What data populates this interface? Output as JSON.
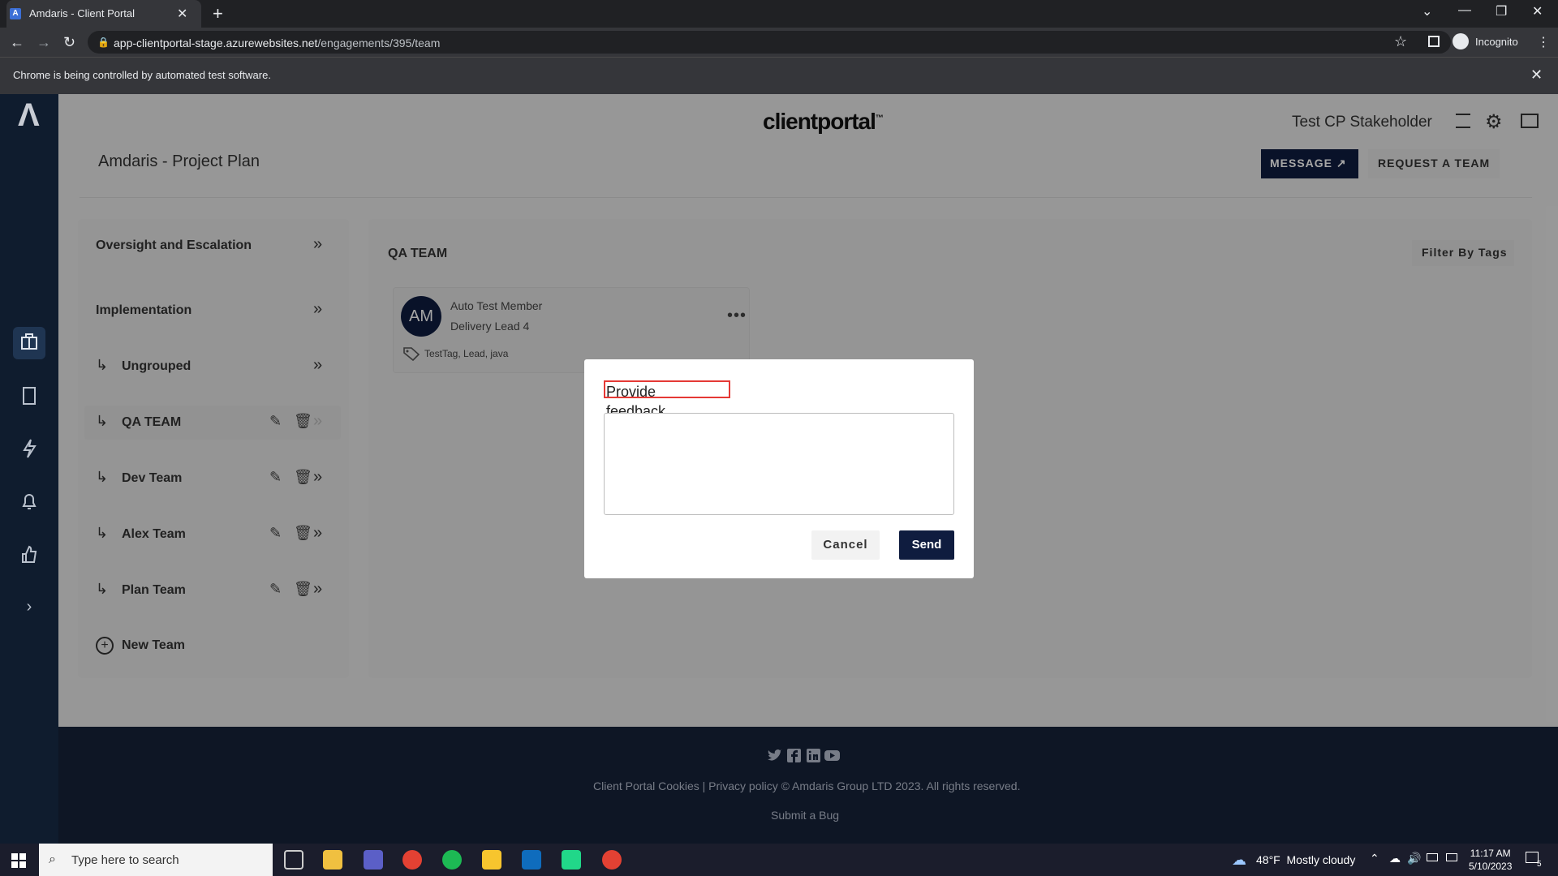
{
  "browser": {
    "tab_title": "Amdaris - Client Portal",
    "url_host": "app-clientportal-stage.azurewebsites.net",
    "url_path": "/engagements/395/team",
    "profile": "Incognito",
    "infobar_text": "Chrome is being controlled by automated test software."
  },
  "header": {
    "brand": "clientportal",
    "brand_mark": "™",
    "user": "Test CP Stakeholder"
  },
  "plan": {
    "title": "Amdaris - Project Plan",
    "message_label": "MESSAGE",
    "request_label": "REQUEST A TEAM"
  },
  "left_panel": {
    "groups": [
      {
        "label": "Oversight and Escalation"
      },
      {
        "label": "Implementation"
      }
    ],
    "teams": [
      {
        "label": "Ungrouped"
      },
      {
        "label": "QA TEAM"
      },
      {
        "label": "Dev Team"
      },
      {
        "label": "Alex Team"
      },
      {
        "label": "Plan Team"
      }
    ],
    "new_team": "New Team"
  },
  "team": {
    "title": "QA TEAM",
    "filter_label": "Filter By Tags",
    "member": {
      "initials": "AM",
      "name": "Auto Test Member",
      "role": "Delivery Lead 4",
      "tags": "TestTag, Lead, java"
    }
  },
  "modal": {
    "title": "Provide feedback",
    "textarea_value": "",
    "cancel_label": "Cancel",
    "send_label": "Send"
  },
  "footer": {
    "links": "Client Portal Cookies | Privacy policy © Amdaris Group LTD 2023. All rights reserved.",
    "bug": "Submit a Bug"
  },
  "taskbar": {
    "search_placeholder": "Type here to search",
    "weather_temp": "48°F",
    "weather_text": "Mostly cloudy",
    "time": "11:17 AM",
    "date": "5/10/2023",
    "notif_count": "5"
  },
  "colors": {
    "navy": "#0f1c3f",
    "sidebar": "#0f1c2e",
    "highlight": "#e53935"
  }
}
